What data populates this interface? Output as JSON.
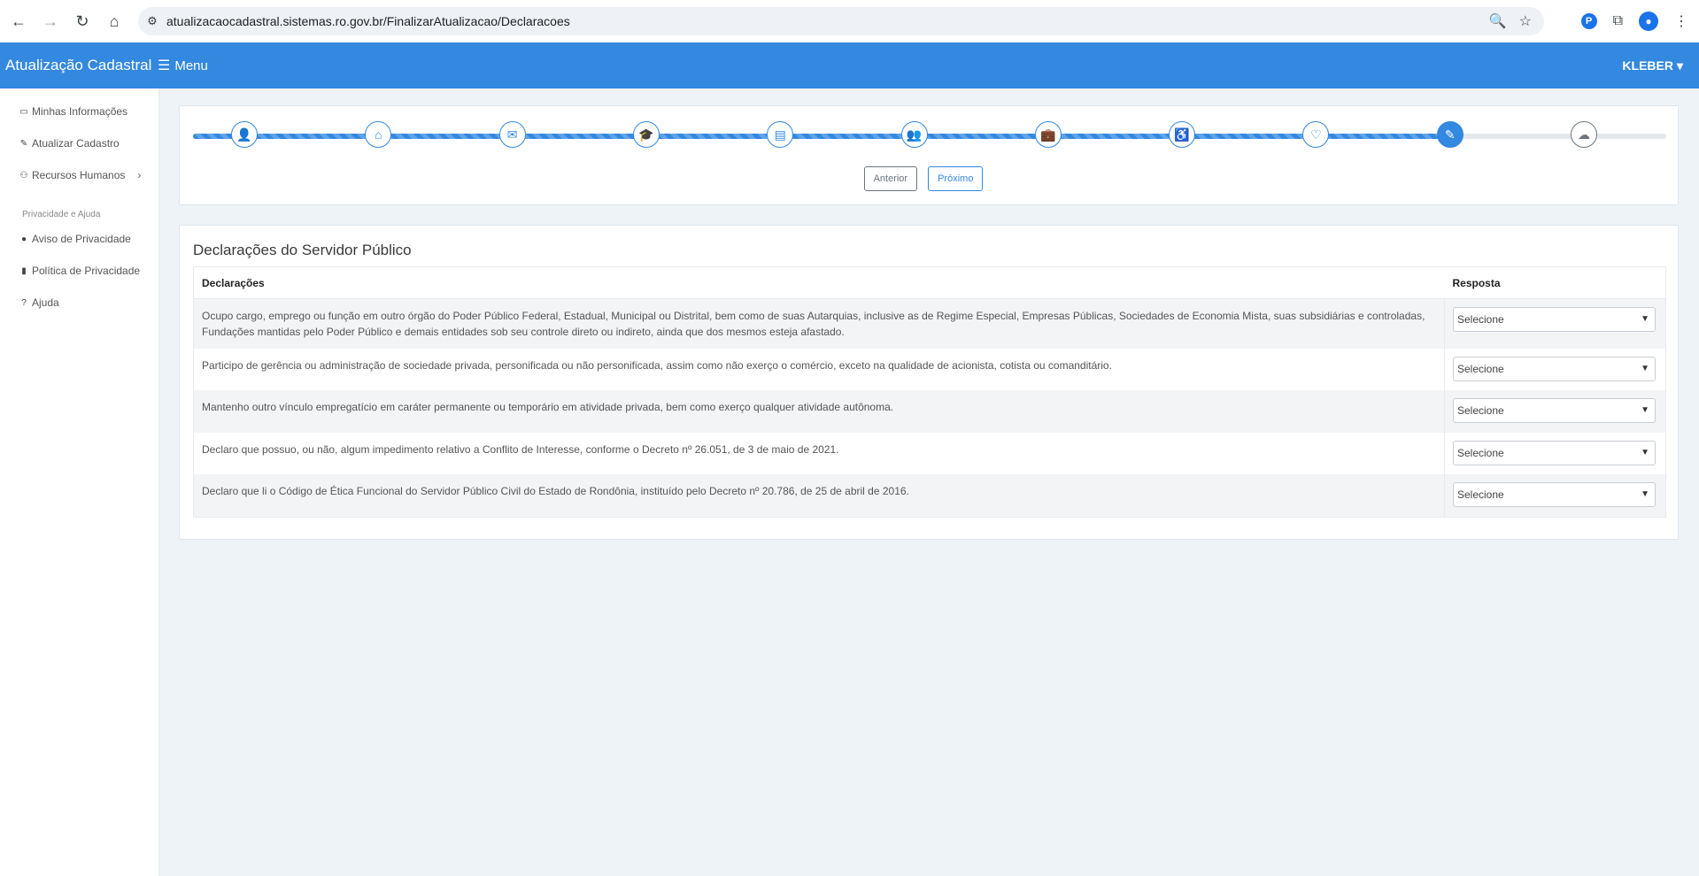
{
  "browser": {
    "url": "atualizacaocadastral.sistemas.ro.gov.br/FinalizarAtualizacao/Declaracoes"
  },
  "navbar": {
    "brand": "Atualização Cadastral",
    "menu_label": "Menu",
    "user": "KLEBER"
  },
  "sidebar": {
    "items": [
      {
        "label": "Minhas Informações",
        "icon": "id-card-icon"
      },
      {
        "label": "Atualizar Cadastro",
        "icon": "user-edit-icon"
      },
      {
        "label": "Recursos Humanos",
        "icon": "users-icon"
      }
    ],
    "section_heading": "Privacidade e Ajuda",
    "help_items": [
      {
        "label": "Aviso de Privacidade",
        "icon": "info-circle-icon"
      },
      {
        "label": "Política de Privacidade",
        "icon": "file-icon"
      },
      {
        "label": "Ajuda",
        "icon": "question-circle-icon"
      }
    ]
  },
  "stepper": {
    "steps": [
      {
        "icon": "user-icon",
        "glyph": "👤",
        "state": "done"
      },
      {
        "icon": "home-icon",
        "glyph": "⌂",
        "state": "done"
      },
      {
        "icon": "envelope-icon",
        "glyph": "✉",
        "state": "done"
      },
      {
        "icon": "graduation-icon",
        "glyph": "🎓",
        "state": "done"
      },
      {
        "icon": "document-icon",
        "glyph": "▤",
        "state": "done"
      },
      {
        "icon": "people-icon",
        "glyph": "👥",
        "state": "done"
      },
      {
        "icon": "briefcase-icon",
        "glyph": "💼",
        "state": "done"
      },
      {
        "icon": "wheelchair-icon",
        "glyph": "♿",
        "state": "done"
      },
      {
        "icon": "heartbeat-icon",
        "glyph": "♡",
        "state": "done"
      },
      {
        "icon": "pen-icon",
        "glyph": "✎",
        "state": "active"
      },
      {
        "icon": "cloud-upload-icon",
        "glyph": "☁",
        "state": "pending"
      }
    ],
    "progress_fraction": 0.85,
    "prev_label": "Anterior",
    "next_label": "Próximo"
  },
  "declarations": {
    "title": "Declarações do Servidor Público",
    "col_declaration": "Declarações",
    "col_answer": "Resposta",
    "rows": [
      {
        "text": "Ocupo cargo, emprego ou função em outro órgão do Poder Público Federal, Estadual, Municipal ou Distrital, bem como de suas Autarquias, inclusive as de Regime Especial, Empresas Públicas, Sociedades de Economia Mista, suas subsidiárias e controladas, Fundações mantidas pelo Poder Público e demais entidades sob seu controle direto ou indireto, ainda que dos mesmos esteja afastado.",
        "answer": "Selecione"
      },
      {
        "text": "Participo de gerência ou administração de sociedade privada, personificada ou não personificada, assim como não exerço o comércio, exceto na qualidade de acionista, cotista ou comanditário.",
        "answer": "Selecione"
      },
      {
        "text": "Mantenho outro vínculo empregatício em caráter permanente ou temporário em atividade privada, bem como exerço qualquer atividade autônoma.",
        "answer": "Selecione"
      },
      {
        "text": "Declaro que possuo, ou não, algum impedimento relativo a Conflito de Interesse, conforme o Decreto nº 26.051, de 3 de maio de 2021.",
        "answer": "Selecione"
      },
      {
        "text": "Declaro que li o Código de Ética Funcional do Servidor Público Civil do Estado de Rondônia, instituído pelo Decreto nº 20.786, de 25 de abril de 2016.",
        "answer": "Selecione"
      }
    ]
  }
}
